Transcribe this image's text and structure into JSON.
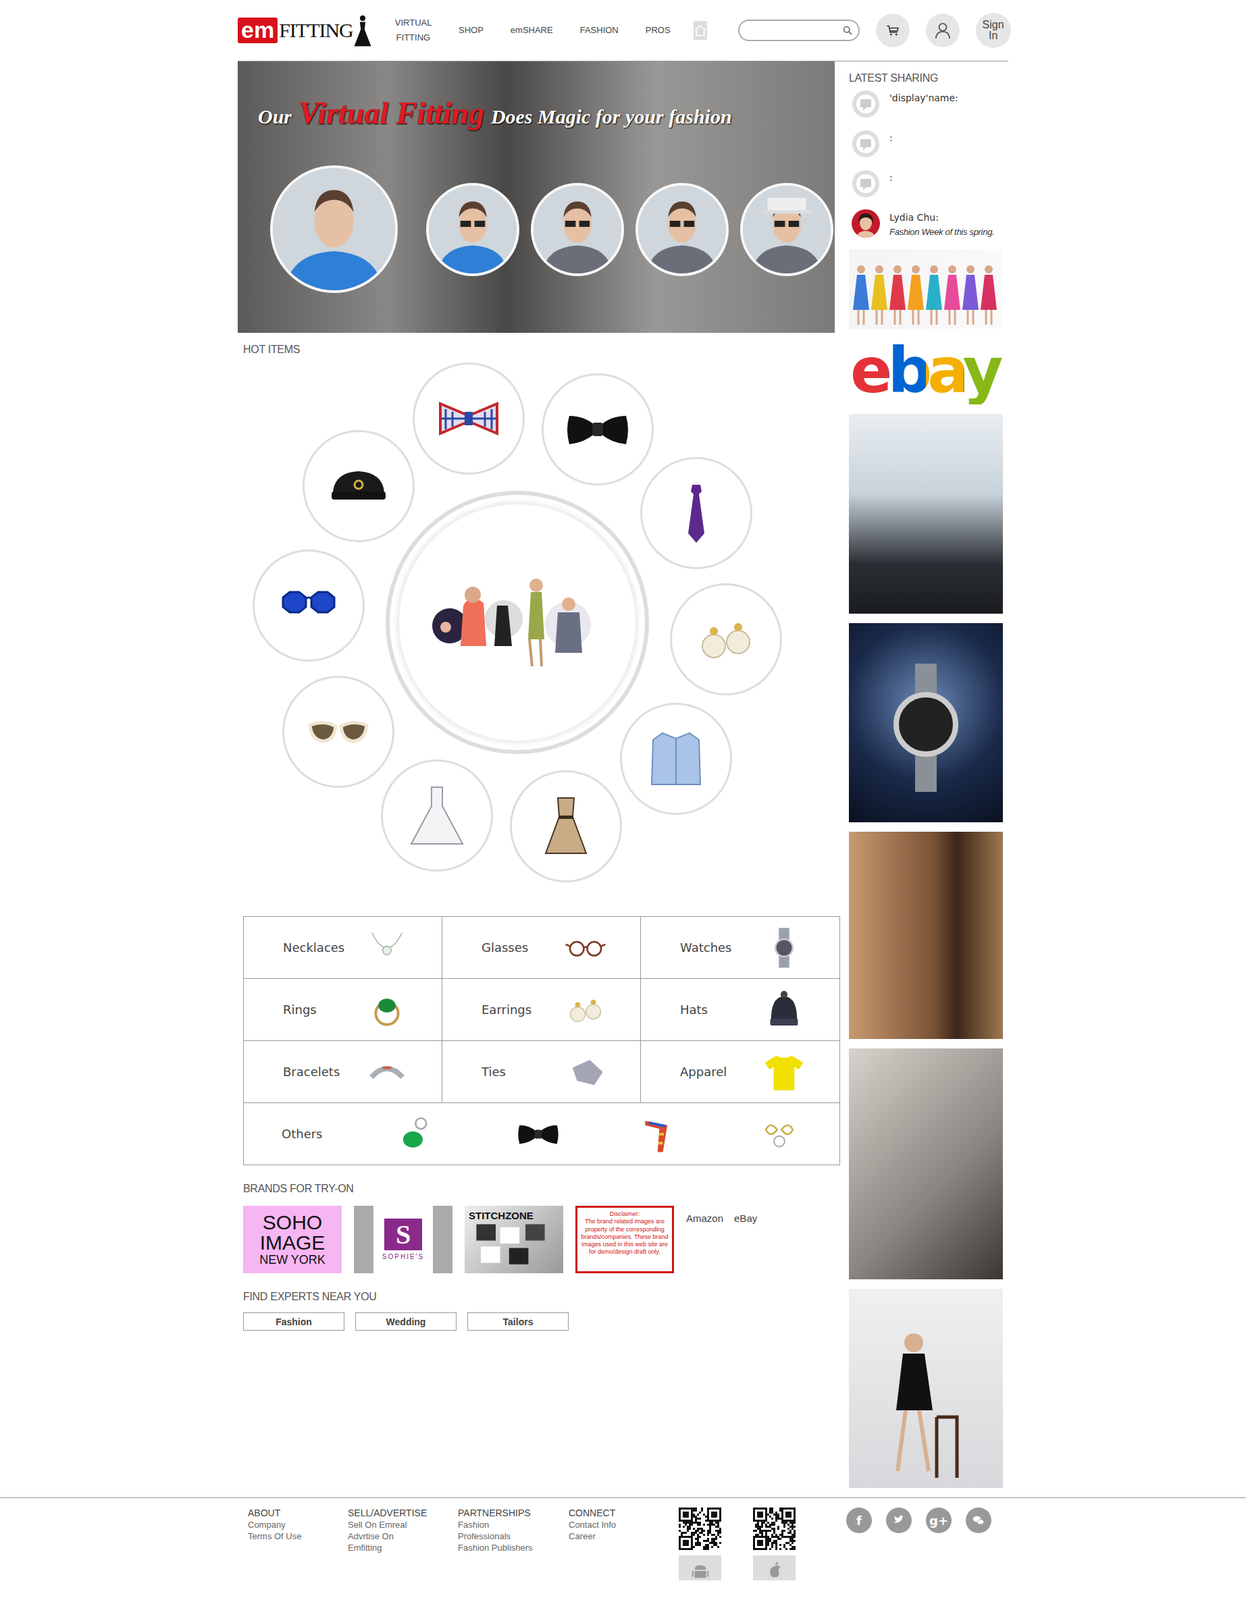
{
  "header": {
    "logo": {
      "em": "em",
      "fitting": "FITTING"
    },
    "nav": [
      {
        "label": "VIRTUAL FITTING"
      },
      {
        "label": "SHOP"
      },
      {
        "label": "emSHARE"
      },
      {
        "label": "FASHION"
      },
      {
        "label": "PROS"
      }
    ],
    "search": {
      "placeholder": ""
    },
    "sign_in": "Sign In"
  },
  "banner": {
    "tagline": {
      "before": "Our",
      "highlight": "Virtual Fitting",
      "after": "Does Magic for your fashion"
    }
  },
  "hot_items": {
    "title": "HOT ITEMS",
    "items": [
      {
        "kind": "hat"
      },
      {
        "kind": "bowtie"
      },
      {
        "kind": "bowtie-black"
      },
      {
        "kind": "tie"
      },
      {
        "kind": "earrings"
      },
      {
        "kind": "jacket"
      },
      {
        "kind": "dress"
      },
      {
        "kind": "gown"
      },
      {
        "kind": "sunglasses"
      },
      {
        "kind": "sunglasses-blue"
      }
    ]
  },
  "categories": {
    "items": [
      {
        "label": "Necklaces",
        "kind": "necklace"
      },
      {
        "label": "Glasses",
        "kind": "glasses"
      },
      {
        "label": "Watches",
        "kind": "watch"
      },
      {
        "label": "Rings",
        "kind": "ring"
      },
      {
        "label": "Earrings",
        "kind": "earrings"
      },
      {
        "label": "Hats",
        "kind": "beanie"
      },
      {
        "label": "Bracelets",
        "kind": "bracelet"
      },
      {
        "label": "Ties",
        "kind": "tie-gray"
      },
      {
        "label": "Apparel",
        "kind": "tshirt"
      }
    ],
    "others": {
      "label": "Others",
      "items": [
        {
          "kind": "keychain"
        },
        {
          "kind": "bowtie-black"
        },
        {
          "kind": "scarf"
        },
        {
          "kind": "keyring"
        }
      ]
    }
  },
  "brands": {
    "title": "BRANDS FOR TRY-ON",
    "soho": {
      "name": "SOHO IMAGE",
      "city": "NEW YORK"
    },
    "sophies": {
      "mark": "S",
      "name": "SOPHIE'S"
    },
    "stitchzone": "STITCHZONE",
    "disclaimer": {
      "title": "Disclaimer:",
      "body": "The brand related images are property of the corresponding brands/companies. These brand images used in this web site are for demo/design draft only."
    },
    "links": [
      "Amazon",
      "eBay"
    ]
  },
  "experts": {
    "title": "FIND EXPERTS NEAR YOU",
    "buttons": [
      "Fashion",
      "Wedding",
      "Tailors"
    ]
  },
  "sidebar": {
    "title": "LATEST SHARING",
    "sharing": [
      {
        "name": "'display'name:",
        "avatar": "placeholder"
      },
      {
        "name": ":",
        "avatar": "placeholder"
      },
      {
        "name": ":",
        "avatar": "placeholder"
      },
      {
        "name": "Lydia Chu:",
        "text": "Fashion Week of this spring.",
        "avatar": "photo"
      }
    ],
    "ebay_logo": "ebay"
  },
  "footer": {
    "columns": [
      {
        "title": "ABOUT",
        "links": [
          "Company",
          "Terms Of Use"
        ]
      },
      {
        "title": "SELL/ADVERTISE",
        "links": [
          "Sell On Emreal",
          "Advrtise On Emfitting"
        ]
      },
      {
        "title": "PARTNERSHIPS",
        "links": [
          "Fashion",
          "Professionals",
          "Fashion Publishers"
        ]
      },
      {
        "title": "CONNECT",
        "links": [
          "Contact Info",
          "Career"
        ]
      }
    ],
    "apps": [
      {
        "kind": "android"
      },
      {
        "kind": "apple"
      }
    ],
    "social": [
      {
        "kind": "facebook",
        "glyph": "f"
      },
      {
        "kind": "twitter"
      },
      {
        "kind": "google",
        "glyph": "g+"
      },
      {
        "kind": "wechat"
      }
    ]
  }
}
